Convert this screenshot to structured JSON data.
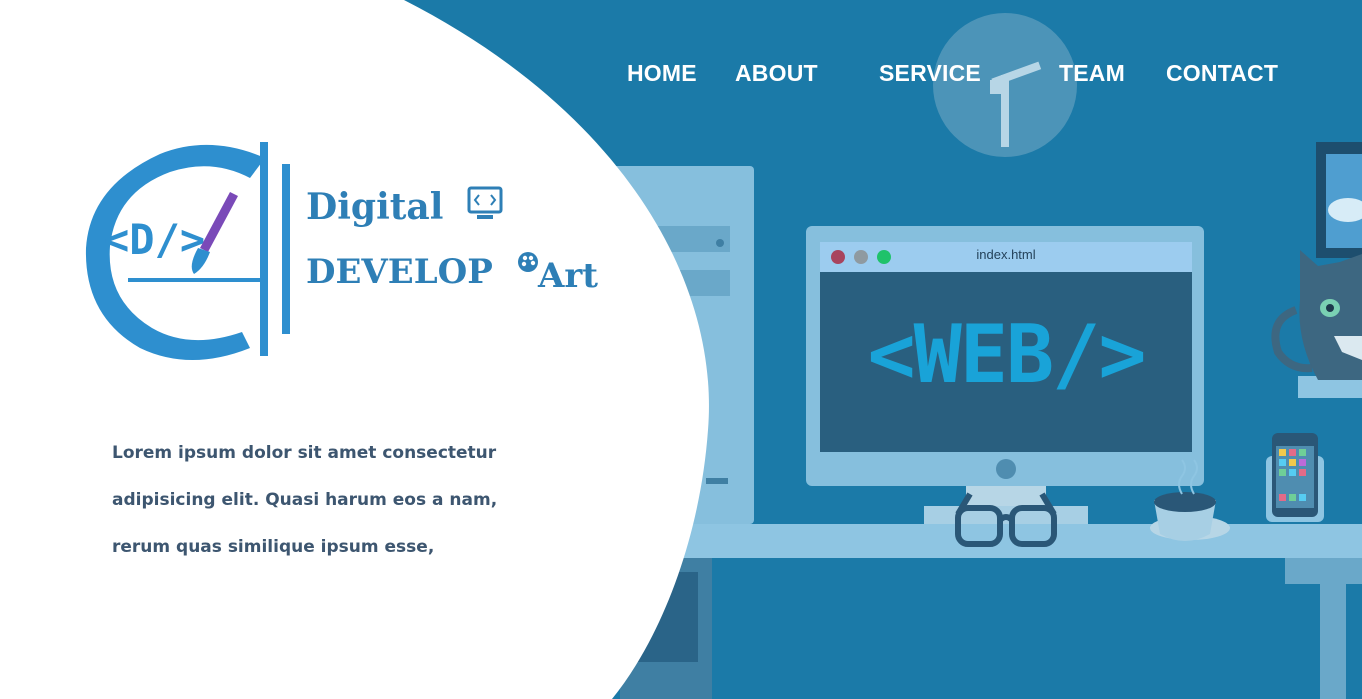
{
  "nav": {
    "items": [
      {
        "label": "HOME"
      },
      {
        "label": "ABOUT"
      },
      {
        "label": "SERVICE"
      },
      {
        "label": "TEAM"
      },
      {
        "label": "CONTACT"
      }
    ]
  },
  "brand": {
    "line1": "Digital",
    "line2": "DEVELOP",
    "line2_suffix": "Art",
    "logo_mark_text": "<D/>"
  },
  "intro": {
    "lines": [
      "Lorem ipsum dolor sit amet consectetur",
      "adipisicing elit. Quasi harum eos a nam,",
      "rerum quas similique ipsum esse,"
    ]
  },
  "illustration": {
    "browser_tab_title": "index.html",
    "screen_text": "<WEB/>"
  },
  "colors": {
    "background": "#1b7aa8",
    "panel": "#ffffff",
    "brand": "#2e7fb6",
    "accent": "#19a3d8",
    "body_text": "#3d5670"
  }
}
